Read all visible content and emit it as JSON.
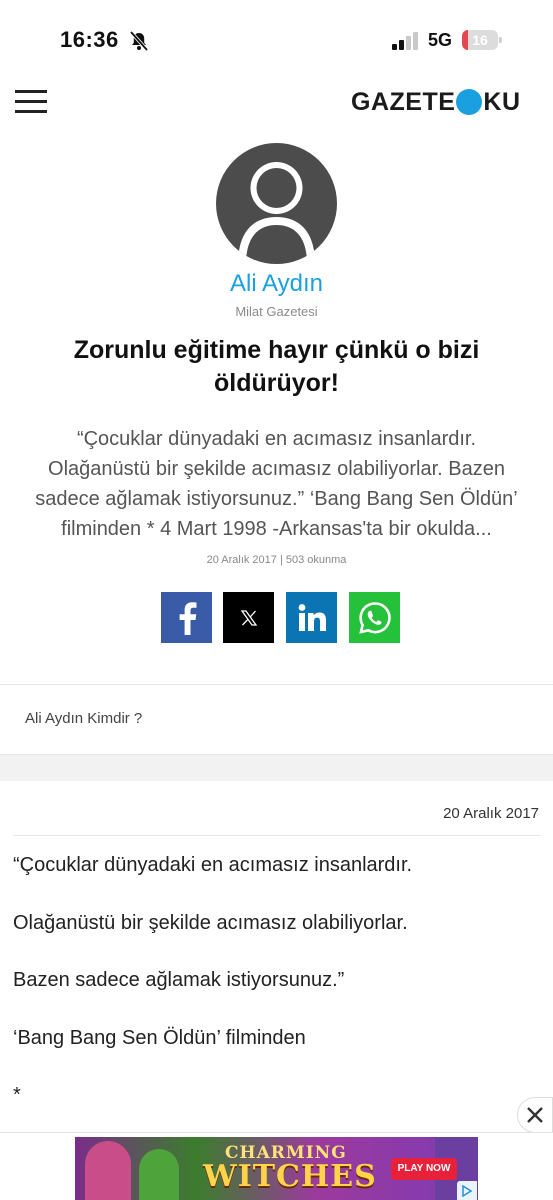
{
  "status_bar": {
    "time": "16:36",
    "network": "5G",
    "battery_level": "16",
    "battery_fraction": 0.16,
    "battery_color": "#e5484d"
  },
  "header": {
    "logo_left": "GAZETE",
    "logo_right": "KU",
    "logo_dot_color": "#1a9fe0",
    "menu_icon": "hamburger-icon"
  },
  "author": {
    "name": "Ali Aydın",
    "paper": "Milat Gazetesi",
    "avatar_icon": "default-user-avatar-icon"
  },
  "article": {
    "title": "Zorunlu eğitime hayır çünkü o bizi öldürüyor!",
    "summary": "“Çocuklar dünyadaki en acımasız insanlardır. Olağanüstü bir şekilde acımasız olabiliyorlar. Bazen sadece ağlamak istiyorsunuz.” ‘Bang Bang Sen Öldün’ filminden * 4 Mart 1998 -Arkansas'ta bir okulda...",
    "meta": "20 Aralık 2017 | 503 okunma"
  },
  "share": {
    "facebook": {
      "icon": "facebook-icon",
      "color": "#3a5ba8"
    },
    "x": {
      "icon": "x-twitter-icon",
      "color": "#000000"
    },
    "linkedin": {
      "icon": "linkedin-icon",
      "color": "#0a75b2"
    },
    "whatsapp": {
      "icon": "whatsapp-icon",
      "color": "#25c13a"
    }
  },
  "who_is_link": "Ali Aydın Kimdir ?",
  "body": {
    "date": "20 Aralık 2017",
    "lines": [
      "“Çocuklar dünyadaki en acımasız insanlardır.",
      "Olağanüstü bir şekilde acımasız olabiliyorlar.",
      "Bazen sadece ağlamak istiyorsunuz.”",
      "‘Bang Bang Sen Öldün’ filminden",
      "*"
    ]
  },
  "ad": {
    "title_line1": "CHARMING",
    "title_line2": "WITCHES",
    "cta": "PLAY NOW",
    "close_icon": "close-icon",
    "choices_icon": "ad-choices-icon"
  }
}
